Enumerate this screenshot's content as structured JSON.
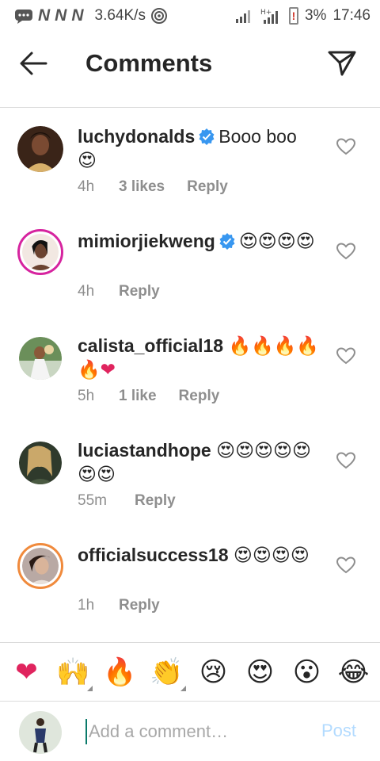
{
  "status_bar": {
    "network_icons": [
      "N",
      "N",
      "N"
    ],
    "speed": "3.64K/s",
    "battery_percent": "3%",
    "battery_warning": "!",
    "time": "17:46",
    "icons": [
      "chat-icon",
      "hotspot-icon",
      "signal-icon",
      "signal-hplus-icon",
      "battery-icon"
    ]
  },
  "header": {
    "title": "Comments",
    "back_icon": "arrow-left-icon",
    "send_icon": "paper-plane-icon"
  },
  "comments": [
    {
      "username": "luchydonalds",
      "verified": true,
      "text": "Booo boo",
      "emoji": "😍",
      "time": "4h",
      "likes": "3 likes",
      "reply": "Reply",
      "avatar_ring": false
    },
    {
      "username": "mimiorjiekweng",
      "verified": true,
      "text": "",
      "emoji": "😍😍😍😍",
      "time": "4h",
      "likes": "",
      "reply": "Reply",
      "avatar_ring": true
    },
    {
      "username": "calista_official18",
      "verified": false,
      "text": "",
      "emoji": "🔥🔥🔥🔥🔥❤",
      "time": "5h",
      "likes": "1 like",
      "reply": "Reply",
      "avatar_ring": false
    },
    {
      "username": "luciastandhope",
      "verified": false,
      "text": "",
      "emoji": "😍😍😍😍😍😍😍",
      "time": "55m",
      "likes": "",
      "reply": "Reply",
      "avatar_ring": false
    },
    {
      "username": "officialsuccess18",
      "verified": false,
      "text": "",
      "emoji": "😍😍😍😍",
      "time": "1h",
      "likes": "",
      "reply": "Reply",
      "avatar_ring": true
    }
  ],
  "emoji_bar": [
    "❤",
    "🙌",
    "🔥",
    "👏",
    "😢",
    "😍",
    "😮",
    "😂"
  ],
  "composer": {
    "placeholder": "Add a comment…",
    "post_label": "Post"
  },
  "colors": {
    "verified_blue": "#3897f0",
    "meta_gray": "#8e8e8e",
    "post_disabled": "#b3dbff",
    "story_ring": "#d6249f"
  }
}
